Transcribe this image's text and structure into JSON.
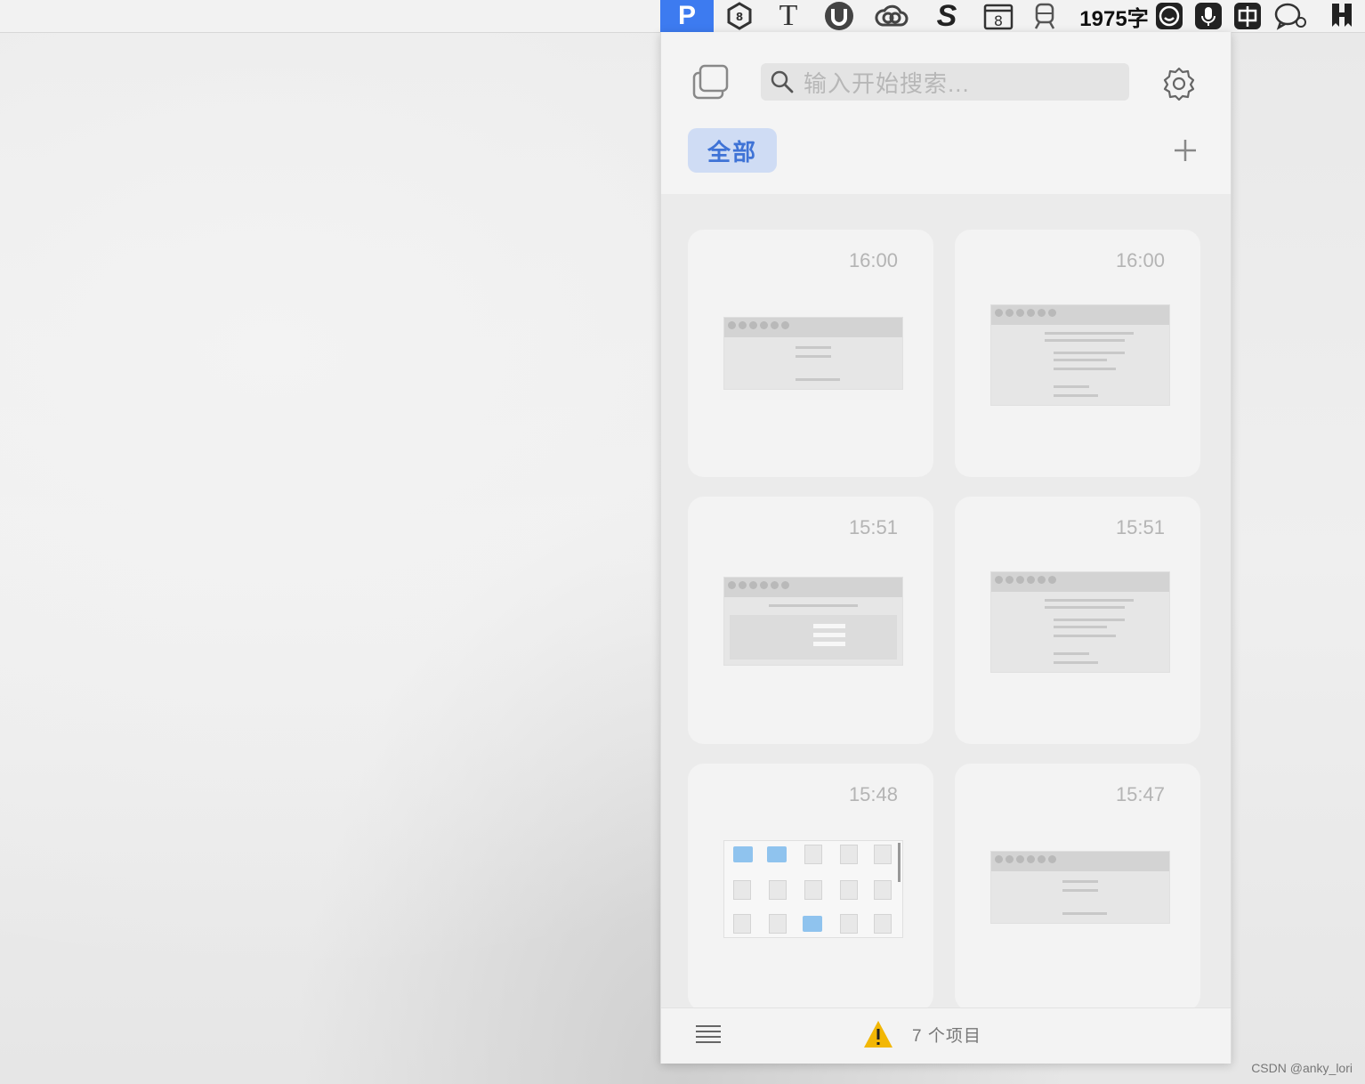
{
  "menubar": {
    "app_label": "P",
    "word_count": "1975字",
    "calendar_day": "8",
    "icons": [
      "p-app-icon",
      "hexagon-app-icon",
      "typora-t-icon",
      "u-app-icon",
      "creative-cloud-icon",
      "s-app-icon",
      "calendar-icon",
      "train-icon",
      "word-count",
      "face-app-icon",
      "microphone-icon",
      "chinese-input-icon",
      "wechat-icon",
      "bookmark-app-icon"
    ]
  },
  "panel": {
    "search_placeholder": "输入开始搜索...",
    "tabs": [
      {
        "label": "全部",
        "active": true
      }
    ],
    "items": [
      {
        "time": "16:00",
        "thumb": "prefs-short"
      },
      {
        "time": "16:00",
        "thumb": "prefs-long"
      },
      {
        "time": "15:51",
        "thumb": "prefs-form"
      },
      {
        "time": "15:51",
        "thumb": "prefs-long"
      },
      {
        "time": "15:48",
        "thumb": "finder-files"
      },
      {
        "time": "15:47",
        "thumb": "prefs-short"
      }
    ],
    "footer": {
      "item_count": "7 个项目",
      "warning_color": "#f2b705"
    }
  },
  "colors": {
    "accent": "#3d7bf0",
    "tab_active_bg": "#cfdcf4",
    "tab_active_text": "#3f73d6"
  },
  "watermark": "CSDN @anky_lori"
}
